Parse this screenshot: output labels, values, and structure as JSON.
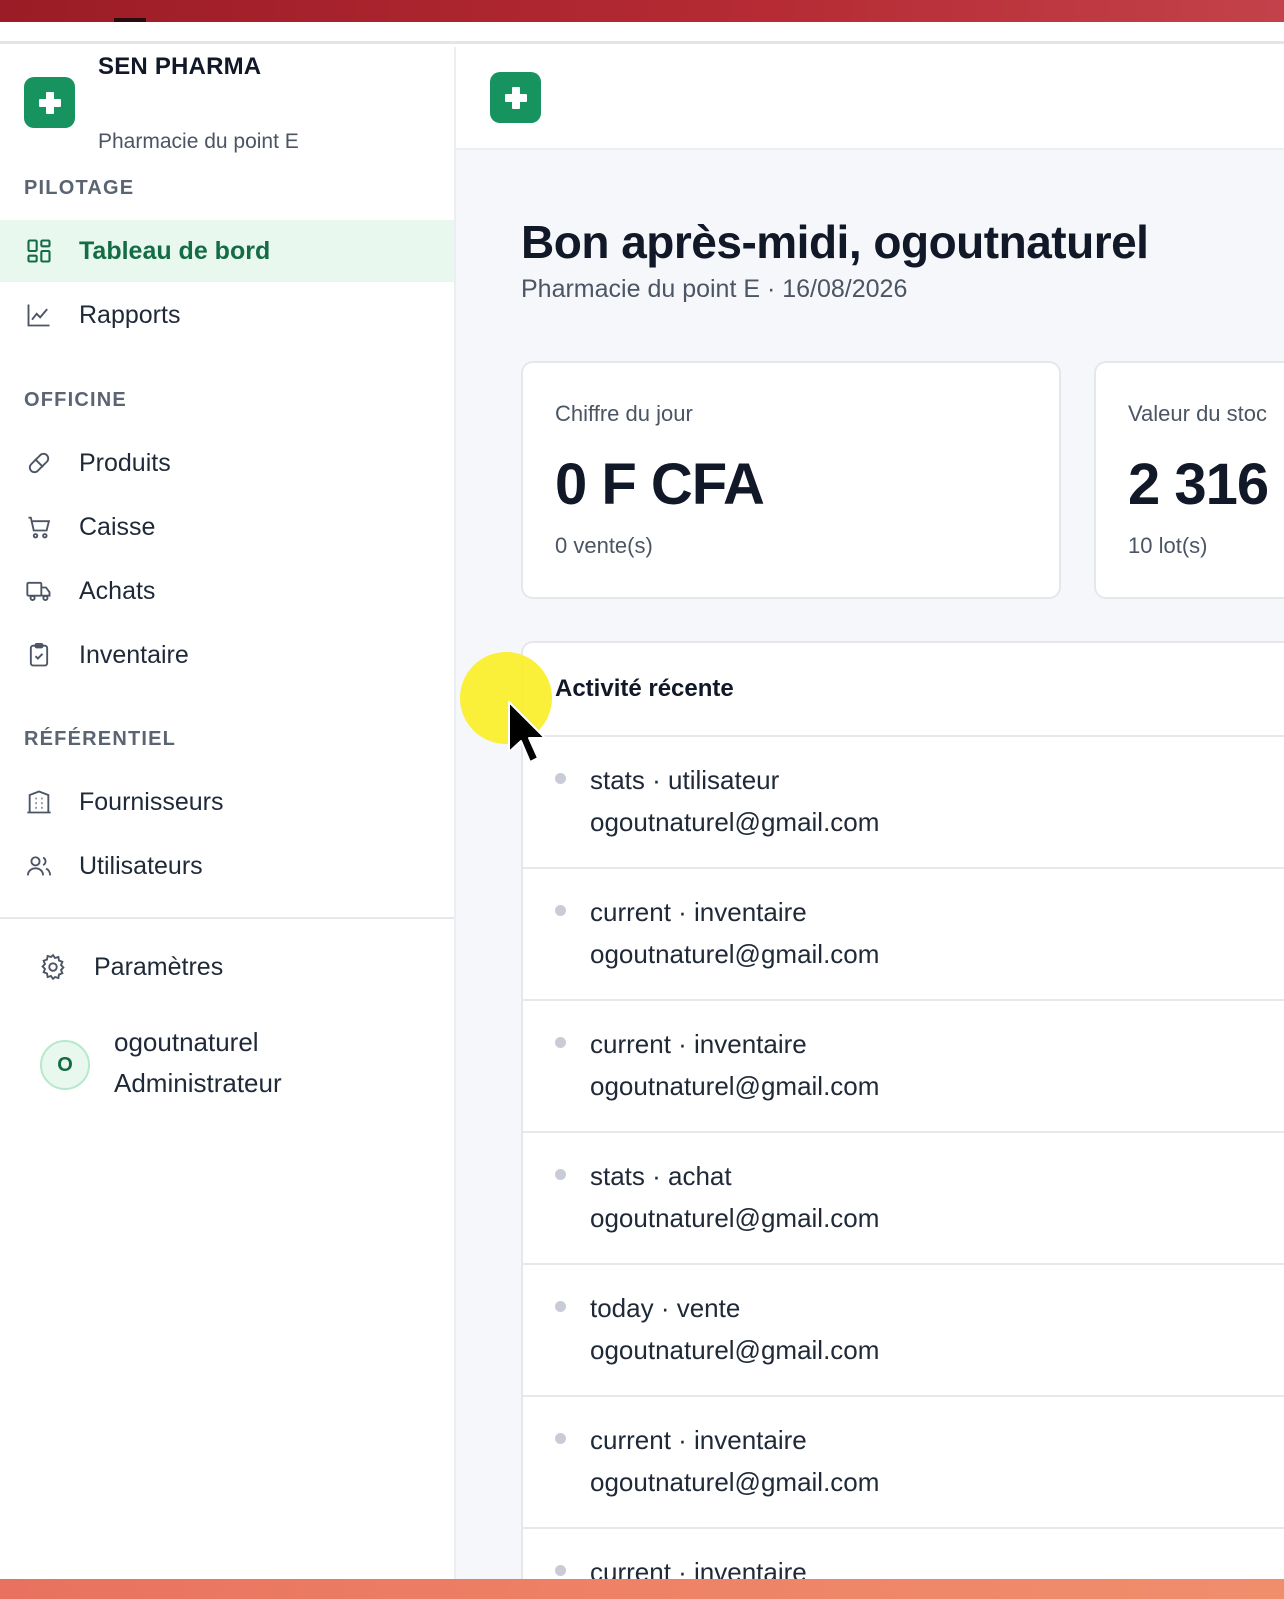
{
  "brand": {
    "name": "SEN PHARMA",
    "pharmacy": "Pharmacie du point E",
    "logo_icon": "plus-icon",
    "accent_color": "#16935e"
  },
  "sidebar": {
    "sections": {
      "pilotage": "PILOTAGE",
      "officine": "OFFICINE",
      "referentiel": "RÉFÉRENTIEL"
    },
    "items": [
      {
        "label": "Tableau de bord",
        "icon": "dashboard-grid-icon",
        "active": true
      },
      {
        "label": "Rapports",
        "icon": "line-chart-icon",
        "active": false
      },
      {
        "label": "Produits",
        "icon": "pill-icon",
        "active": false
      },
      {
        "label": "Caisse",
        "icon": "cart-icon",
        "active": false
      },
      {
        "label": "Achats",
        "icon": "truck-icon",
        "active": false
      },
      {
        "label": "Inventaire",
        "icon": "clipboard-check-icon",
        "active": false
      },
      {
        "label": "Fournisseurs",
        "icon": "building-icon",
        "active": false
      },
      {
        "label": "Utilisateurs",
        "icon": "users-icon",
        "active": false
      }
    ],
    "settings": {
      "label": "Paramètres",
      "icon": "gear-icon"
    },
    "user": {
      "initial": "O",
      "name": "ogoutnaturel",
      "role": "Administrateur"
    }
  },
  "main": {
    "greeting": "Bon après-midi, ogoutnaturel",
    "subline": "Pharmacie du point E · 16/08/2026",
    "kpis": [
      {
        "label": "Chiffre du jour",
        "value": "0 F CFA",
        "sub": "0 vente(s)"
      },
      {
        "label": "Valeur du stoc",
        "value": "2 316",
        "sub": "10 lot(s)"
      }
    ],
    "activity": {
      "title": "Activité récente",
      "rows": [
        {
          "line1": "stats · utilisateur",
          "line2": "ogoutnaturel@gmail.com"
        },
        {
          "line1": "current · inventaire",
          "line2": "ogoutnaturel@gmail.com"
        },
        {
          "line1": "current · inventaire",
          "line2": "ogoutnaturel@gmail.com"
        },
        {
          "line1": "stats · achat",
          "line2": "ogoutnaturel@gmail.com"
        },
        {
          "line1": "today · vente",
          "line2": "ogoutnaturel@gmail.com"
        },
        {
          "line1": "current · inventaire",
          "line2": "ogoutnaturel@gmail.com"
        },
        {
          "line1": "current · inventaire",
          "line2": ""
        }
      ]
    }
  }
}
